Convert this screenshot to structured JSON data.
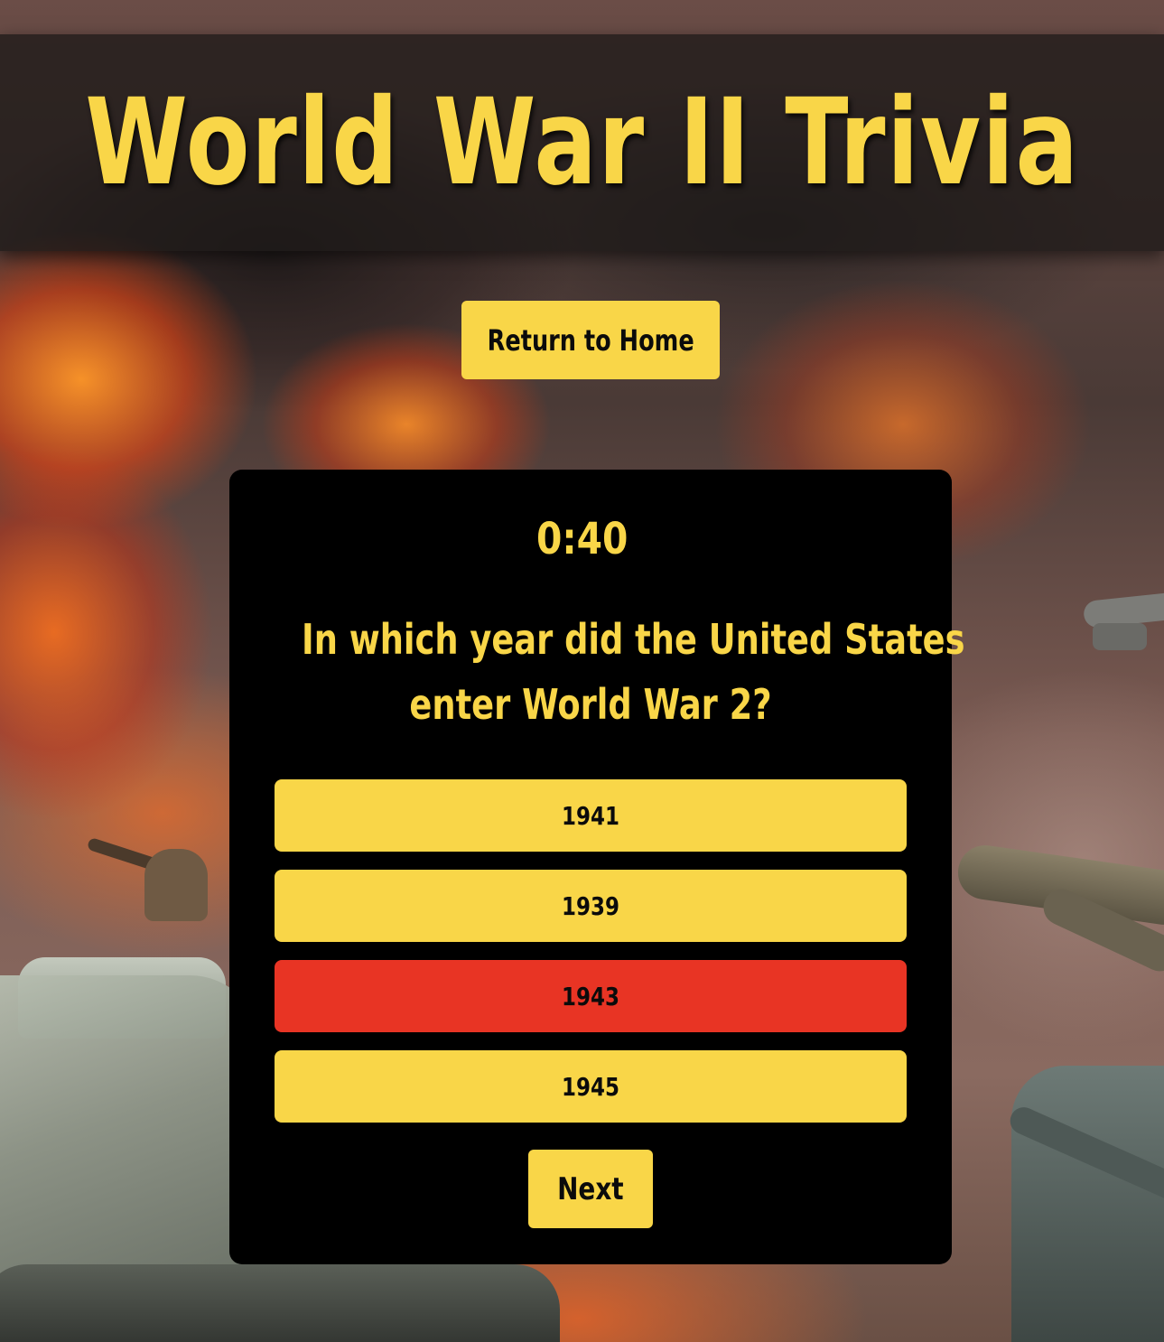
{
  "header": {
    "title": "World War II Trivia"
  },
  "navigation": {
    "return_label": "Return to Home"
  },
  "quiz": {
    "timer": "0:40",
    "question_lines": [
      "In which year did the United States",
      "enter World War 2?"
    ],
    "answers": [
      {
        "label": "1941",
        "state": "default"
      },
      {
        "label": "1939",
        "state": "default"
      },
      {
        "label": "1943",
        "state": "selected-wrong"
      },
      {
        "label": "1945",
        "state": "default"
      }
    ],
    "next_label": "Next"
  },
  "colors": {
    "accent_yellow": "#f9d648",
    "wrong_red": "#e83424",
    "card_background": "#000000",
    "header_overlay": "#1e1a18"
  }
}
